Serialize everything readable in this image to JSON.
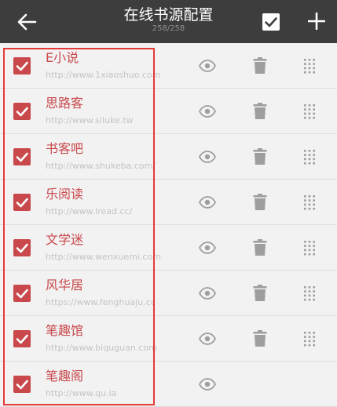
{
  "toolbar": {
    "title": "在线书源配置",
    "count": "258/258",
    "back_icon": "arrow-left-icon",
    "select_all_icon": "checkbox-checked-icon",
    "add_icon": "plus-icon"
  },
  "colors": {
    "toolbar_bg": "#3d3d3d",
    "accent": "#c9484c",
    "url_text": "#c4c4c4",
    "icon_gray": "#9e9e9e",
    "highlight": "#e53935"
  },
  "sources": [
    {
      "name": "E小说",
      "url": "http://www.1xiaoshuo.com",
      "checked": true,
      "deletable": true,
      "draggable": true
    },
    {
      "name": "思路客",
      "url": "http://www.siluke.tw",
      "checked": true,
      "deletable": true,
      "draggable": true
    },
    {
      "name": "书客吧",
      "url": "http://www.shukeba.com/",
      "checked": true,
      "deletable": true,
      "draggable": true
    },
    {
      "name": "乐阅读",
      "url": "http://www.lread.cc/",
      "checked": true,
      "deletable": true,
      "draggable": true
    },
    {
      "name": "文学迷",
      "url": "http://www.wenxuemi.com",
      "checked": true,
      "deletable": true,
      "draggable": true
    },
    {
      "name": "风华居",
      "url": "https://www.fenghuaju.cc",
      "checked": true,
      "deletable": true,
      "draggable": true
    },
    {
      "name": "笔趣馆",
      "url": "http://www.biquguan.com",
      "checked": true,
      "deletable": true,
      "draggable": true
    },
    {
      "name": "笔趣阁",
      "url": "http://www.qu.la",
      "checked": true,
      "deletable": false,
      "draggable": false
    }
  ]
}
